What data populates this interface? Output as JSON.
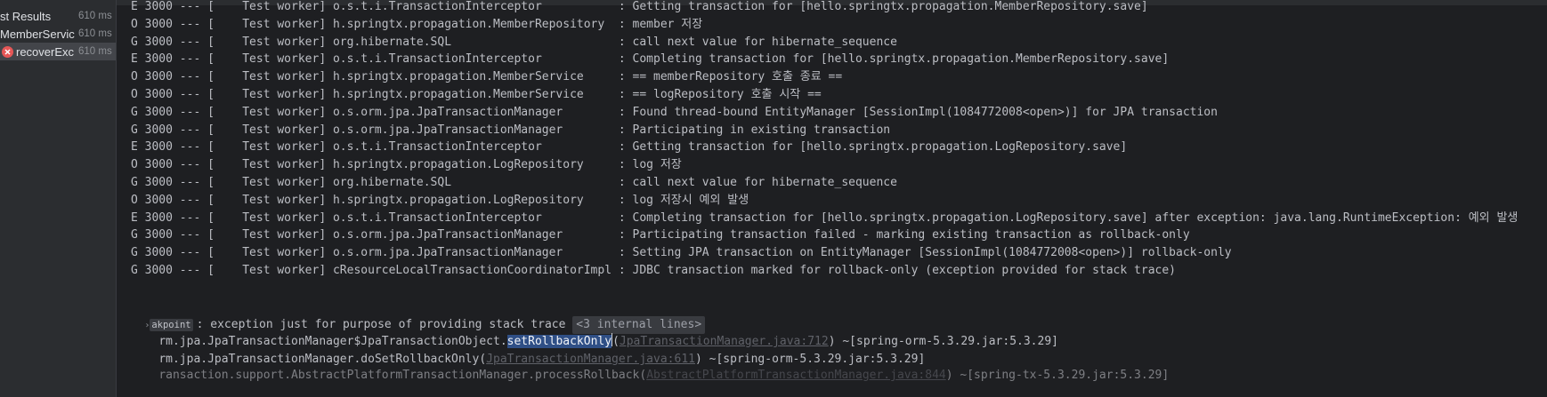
{
  "test_tree": [
    {
      "name": "st Results",
      "time": "610 ms",
      "status": "none",
      "selected": false
    },
    {
      "name": "MemberServic",
      "time": "610 ms",
      "status": "none",
      "selected": false
    },
    {
      "name": "recoverExc",
      "time": "610 ms",
      "status": "failed",
      "selected": true
    }
  ],
  "log_lines": [
    "E 3000 --- [    Test worker] o.s.t.i.TransactionInterceptor           : Getting transaction for [hello.springtx.propagation.MemberRepository.save]",
    "O 3000 --- [    Test worker] h.springtx.propagation.MemberRepository  : member 저장",
    "G 3000 --- [    Test worker] org.hibernate.SQL                        : call next value for hibernate_sequence",
    "E 3000 --- [    Test worker] o.s.t.i.TransactionInterceptor           : Completing transaction for [hello.springtx.propagation.MemberRepository.save]",
    "O 3000 --- [    Test worker] h.springtx.propagation.MemberService     : == memberRepository 호출 종료 ==",
    "O 3000 --- [    Test worker] h.springtx.propagation.MemberService     : == logRepository 호출 시작 ==",
    "G 3000 --- [    Test worker] o.s.orm.jpa.JpaTransactionManager        : Found thread-bound EntityManager [SessionImpl(1084772008<open>)] for JPA transaction",
    "G 3000 --- [    Test worker] o.s.orm.jpa.JpaTransactionManager        : Participating in existing transaction",
    "E 3000 --- [    Test worker] o.s.t.i.TransactionInterceptor           : Getting transaction for [hello.springtx.propagation.LogRepository.save]",
    "O 3000 --- [    Test worker] h.springtx.propagation.LogRepository     : log 저장",
    "G 3000 --- [    Test worker] org.hibernate.SQL                        : call next value for hibernate_sequence",
    "O 3000 --- [    Test worker] h.springtx.propagation.LogRepository     : log 저장시 예외 발생",
    "E 3000 --- [    Test worker] o.s.t.i.TransactionInterceptor           : Completing transaction for [hello.springtx.propagation.LogRepository.save] after exception: java.lang.RuntimeException: 예외 발생",
    "G 3000 --- [    Test worker] o.s.orm.jpa.JpaTransactionManager        : Participating transaction failed - marking existing transaction as rollback-only",
    "G 3000 --- [    Test worker] o.s.orm.jpa.JpaTransactionManager        : Setting JPA transaction on EntityManager [SessionImpl(1084772008<open>)] rollback-only",
    "G 3000 --- [    Test worker] cResourceLocalTransactionCoordinatorImpl : JDBC transaction marked for rollback-only (exception provided for stack trace)"
  ],
  "trace": {
    "breakpoint_tag": "akpoint",
    "exception_msg": ": exception just for purpose of providing stack trace",
    "internal_lines": "<3 internal lines>",
    "line1_prefix": "rm.jpa.JpaTransactionManager$JpaTransactionObject.",
    "line1_selected": "setRollbackOnly",
    "line1_link": "JpaTransactionManager.java:712",
    "line1_suffix": ") ~[spring-orm-5.3.29.jar:5.3.29]",
    "line2_prefix": "rm.jpa.JpaTransactionManager.doSetRollbackOnly(",
    "line2_link": "JpaTransactionManager.java:611",
    "line2_suffix": ") ~[spring-orm-5.3.29.jar:5.3.29]",
    "line3_prefix": "ransaction.support.AbstractPlatformTransactionManager.processRollback(",
    "line3_link": "AbstractPlatformTransactionManager.java:844",
    "line3_suffix": ") ~[spring-tx-5.3.29.jar:5.3.29]"
  },
  "colors": {
    "background": "#1e1f22",
    "sidebar": "#2b2d30",
    "text": "#bcbec4",
    "selection": "#2f4f86",
    "error": "#e55757"
  }
}
